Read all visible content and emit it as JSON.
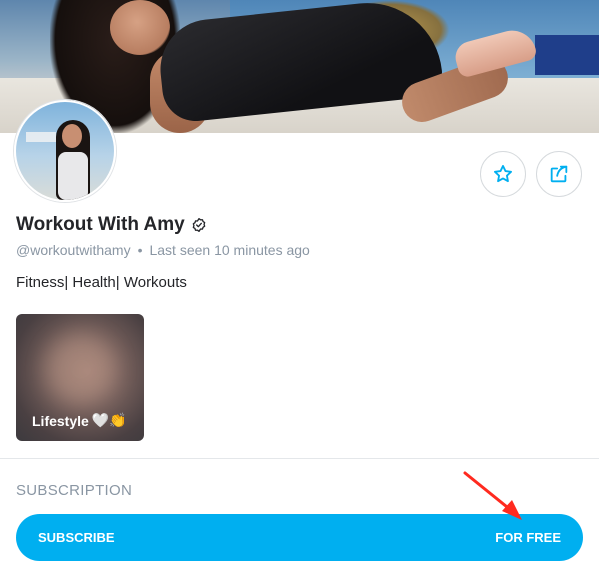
{
  "profile": {
    "name": "Workout With Amy",
    "handle": "@workoutwithamy",
    "separator": "•",
    "last_seen": "Last seen 10 minutes ago",
    "bio": "Fitness| Health| Workouts",
    "verified_icon": "verified-check-icon"
  },
  "actions": {
    "favorite_icon": "star-icon",
    "share_icon": "share-icon"
  },
  "highlights": [
    {
      "label": "Lifestyle",
      "emoji": "🤍👏"
    }
  ],
  "subscription": {
    "section_title": "SUBSCRIPTION",
    "button_left": "SUBSCRIBE",
    "button_right": "FOR FREE"
  },
  "colors": {
    "accent": "#00aff0",
    "muted_text": "#8a96a3",
    "annotation_arrow": "#ff2a1f"
  }
}
